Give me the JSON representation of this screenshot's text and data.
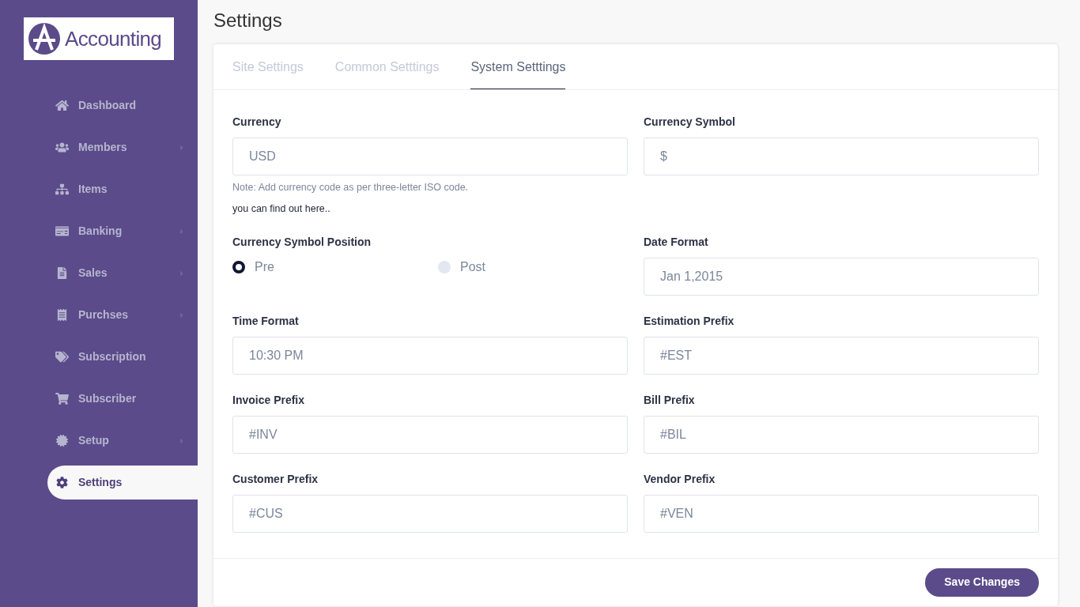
{
  "sidebar": {
    "logo": "Accounting",
    "items": [
      {
        "label": "Dashboard",
        "submenu": false,
        "selected": false
      },
      {
        "label": "Members",
        "submenu": true,
        "selected": false
      },
      {
        "label": "Items",
        "submenu": false,
        "selected": false
      },
      {
        "label": "Banking",
        "submenu": true,
        "selected": false
      },
      {
        "label": "Sales",
        "submenu": true,
        "selected": false
      },
      {
        "label": "Purchses",
        "submenu": true,
        "selected": false
      },
      {
        "label": "Subscription",
        "submenu": false,
        "selected": false
      },
      {
        "label": "Subscriber",
        "submenu": false,
        "selected": false
      },
      {
        "label": "Setup",
        "submenu": true,
        "selected": false
      },
      {
        "label": "Settings",
        "submenu": false,
        "selected": true
      }
    ]
  },
  "page_title": "Settings",
  "tabs": [
    {
      "label": "Site Settings",
      "selected": false
    },
    {
      "label": "Common Setttings",
      "selected": false
    },
    {
      "label": "System Setttings",
      "selected": true
    }
  ],
  "fields": [
    {
      "kind": "text",
      "label": "Currency",
      "value": "USD",
      "note": "Note: Add currency code as per three-letter ISO code.",
      "help": "you can find out here.."
    },
    {
      "kind": "text",
      "label": "Currency Symbol",
      "value": "$"
    },
    {
      "kind": "radio",
      "label": "Currency Symbol Position",
      "options": [
        {
          "label": "Pre",
          "selected": true
        },
        {
          "label": "Post",
          "selected": false
        }
      ]
    },
    {
      "kind": "text",
      "label": "Date Format",
      "value": "Jan 1,2015"
    },
    {
      "kind": "text",
      "label": "Time Format",
      "value": "10:30 PM"
    },
    {
      "kind": "text",
      "label": "Estimation Prefix",
      "value": "#EST"
    },
    {
      "kind": "text",
      "label": "Invoice Prefix",
      "value": "#INV"
    },
    {
      "kind": "text",
      "label": "Bill Prefix",
      "value": "#BIL"
    },
    {
      "kind": "text",
      "label": "Customer Prefix",
      "value": "#CUS"
    },
    {
      "kind": "text",
      "label": "Vendor Prefix",
      "value": "#VEN"
    }
  ],
  "save_button": "Save Changes"
}
